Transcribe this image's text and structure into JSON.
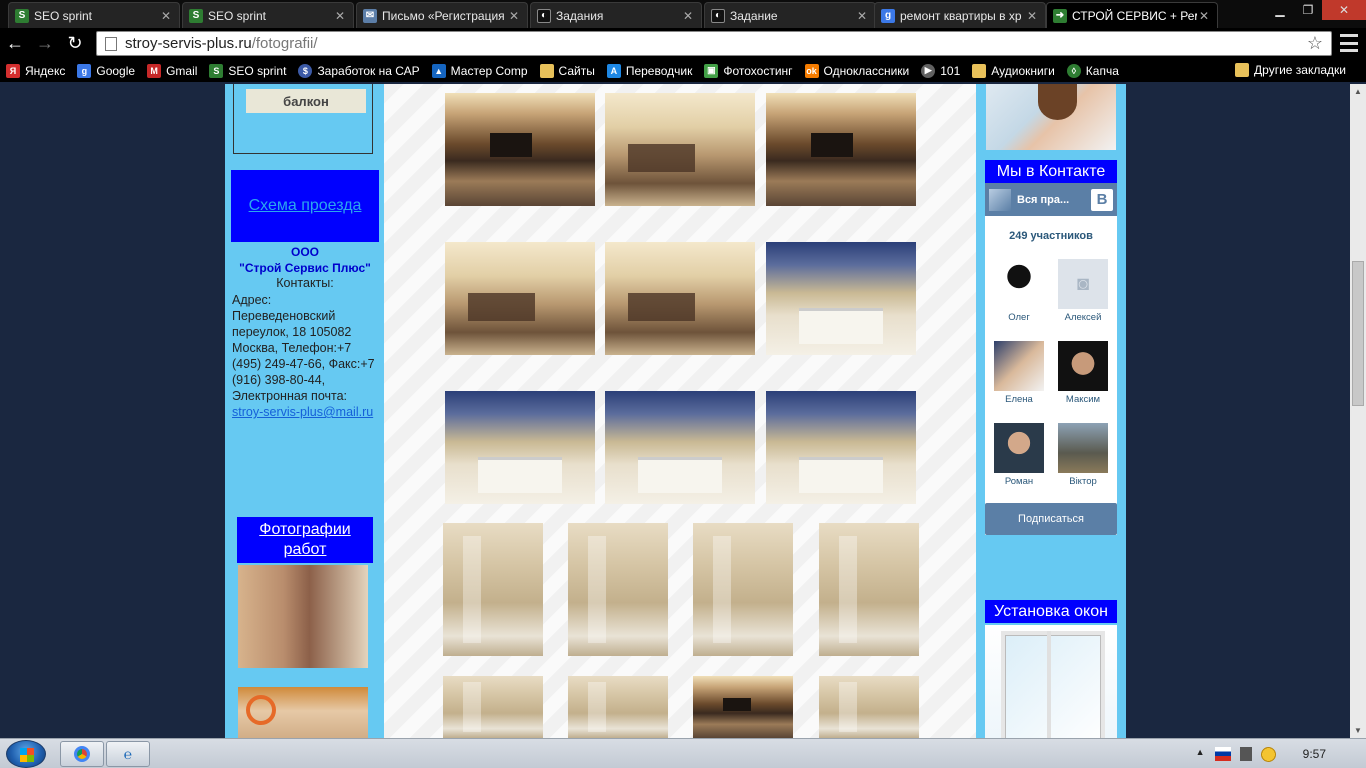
{
  "browser": {
    "tabs": [
      {
        "title": "SEO sprint",
        "icon": "seosprint-icon",
        "active": false
      },
      {
        "title": "SEO sprint",
        "icon": "seosprint-icon",
        "active": false
      },
      {
        "title": "Письмо «Регистрация",
        "icon": "mail-icon",
        "active": false
      },
      {
        "title": "Задания",
        "icon": "tasks-icon",
        "active": false
      },
      {
        "title": "Задание",
        "icon": "tasks-icon",
        "active": false
      },
      {
        "title": "ремонт квартиры в хр",
        "icon": "google-icon",
        "active": false
      },
      {
        "title": "СТРОЙ СЕРВИС + Рем",
        "icon": "site-icon",
        "active": true
      }
    ],
    "url_host": "stroy-servis-plus.ru",
    "url_path": "/fotografii/",
    "bookmarks": [
      {
        "label": "Яндекс",
        "color": "#d32f2f"
      },
      {
        "label": "Google",
        "color": "#3b78e7"
      },
      {
        "label": "Gmail",
        "color": "#c62828"
      },
      {
        "label": "SEO sprint",
        "color": "#2e7d32"
      },
      {
        "label": "Заработок на САР",
        "color": "#3c5aa6"
      },
      {
        "label": "Мастер Comp",
        "color": "#1565c0"
      },
      {
        "label": "Сайты",
        "color": "#e8c15a"
      },
      {
        "label": "Переводчик",
        "color": "#1e88e5"
      },
      {
        "label": "Фотохостинг",
        "color": "#43a047"
      },
      {
        "label": "Одноклассники",
        "color": "#f57c00"
      },
      {
        "label": "101",
        "color": "#616161"
      },
      {
        "label": "Аудиокниги",
        "color": "#e8c15a"
      },
      {
        "label": "Капча",
        "color": "#2e7d32"
      }
    ],
    "other_bookmarks": "Другие закладки"
  },
  "left": {
    "balkon_label": "балкон",
    "schema_label": "Схема проезда",
    "company_line1": "ООО",
    "company_line2": "\"Строй Сервис Плюс\"",
    "contacts_label": "Контакты:",
    "address_text": "Адрес: Переведеновский переулок, 18 105082 Москва, Телефон:+7 (495) 249-47-66, Факс:+7 (916) 398-80-44, Электронная почта: ",
    "email": "stroy-servis-plus@mail.ru",
    "photos_title": "Фотографии работ"
  },
  "right": {
    "vk_title": "Мы в Контакте",
    "vk_group": "Вся пра...",
    "vk_count": "249 участников",
    "members": [
      "Олег",
      "Алексей",
      "Елена",
      "Максим",
      "Роман",
      "Віктор"
    ],
    "subscribe": "Подписаться",
    "windows_title": "Установка окон"
  },
  "taskbar": {
    "clock": "9:57"
  }
}
